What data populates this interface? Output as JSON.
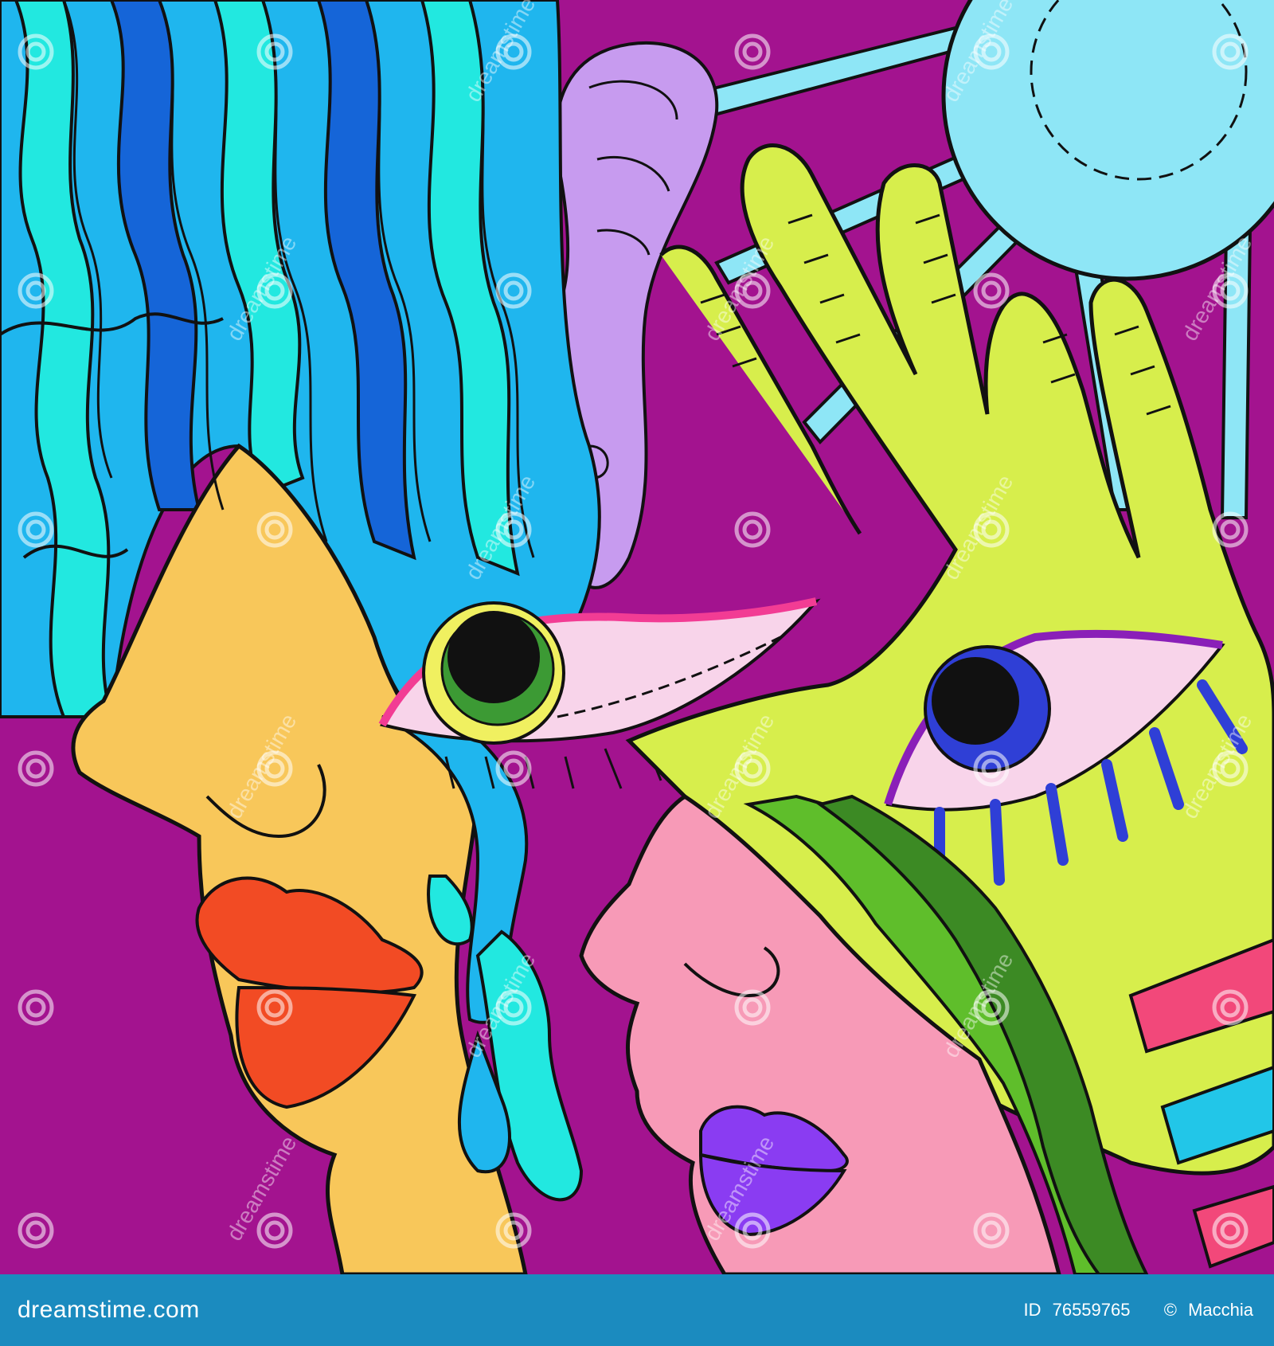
{
  "footer": {
    "site": "dreamstime.com",
    "id_label": "ID",
    "id_value": "76559765",
    "copyright": "©",
    "author": "Macchia"
  },
  "watermark": {
    "text": "dreamstime",
    "icon": "spiral-logo-icon"
  },
  "colors": {
    "background": "#a3138f",
    "footer_bar": "#1b8bbf",
    "hair_blue": "#1fb6ee",
    "hair_dark_blue": "#1565d8",
    "hair_cyan": "#22e8e0",
    "face_yellow": "#f8c75a",
    "lips_orange": "#f24b24",
    "face_pink": "#f79ab7",
    "lips_purple": "#8a3cf2",
    "hand_green": "#d7ee4c",
    "sun_blue": "#8ee6f6",
    "ear_lavender": "#c79bef",
    "eye_white": "#f8d4ea",
    "iris_green": "#3c9a34",
    "iris_blue": "#2f3fd6",
    "hair_green": "#5fbe2b"
  }
}
